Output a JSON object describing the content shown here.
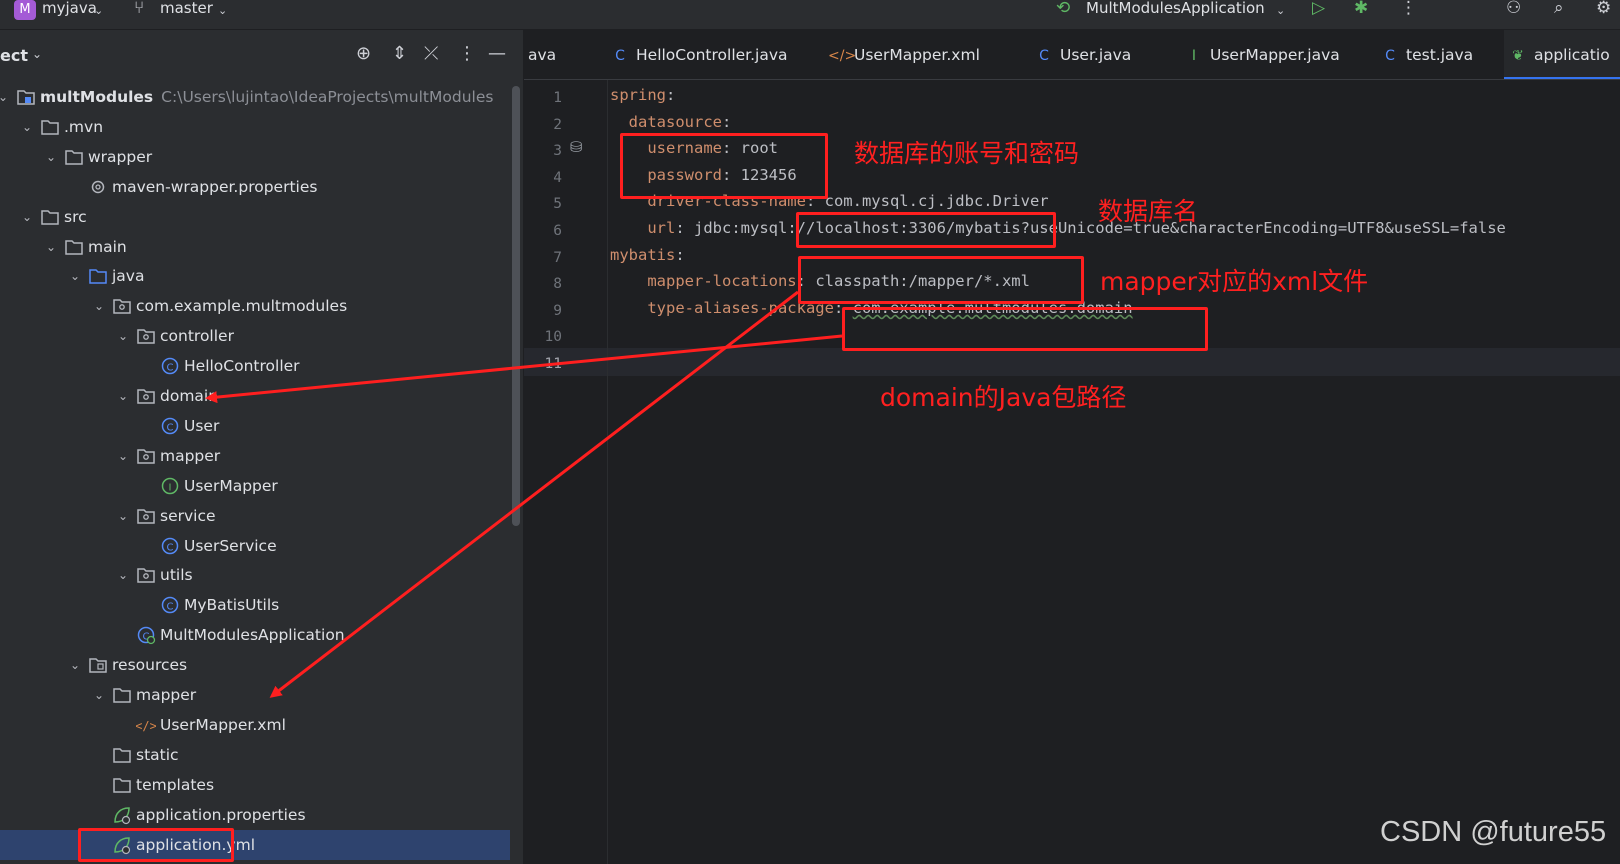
{
  "titlebar": {
    "project_badge": "M",
    "project_name": "myjava",
    "branch": "master",
    "run_config": "MultModulesApplication"
  },
  "sidebar": {
    "title": "ect",
    "tree": [
      {
        "label": "multModules",
        "path": "C:\\Users\\lujintao\\IdeaProjects\\multModules",
        "icon": "module-folder",
        "bold": true
      },
      {
        "label": ".mvn",
        "icon": "folder"
      },
      {
        "label": "wrapper",
        "icon": "folder"
      },
      {
        "label": "maven-wrapper.properties",
        "icon": "gear"
      },
      {
        "label": "src",
        "icon": "folder"
      },
      {
        "label": "main",
        "icon": "folder"
      },
      {
        "label": "java",
        "icon": "source-folder"
      },
      {
        "label": "com.example.multmodules",
        "icon": "package"
      },
      {
        "label": "controller",
        "icon": "package"
      },
      {
        "label": "HelloController",
        "icon": "class"
      },
      {
        "label": "domain",
        "icon": "package"
      },
      {
        "label": "User",
        "icon": "class"
      },
      {
        "label": "mapper",
        "icon": "package"
      },
      {
        "label": "UserMapper",
        "icon": "interface"
      },
      {
        "label": "service",
        "icon": "package"
      },
      {
        "label": "UserService",
        "icon": "class"
      },
      {
        "label": "utils",
        "icon": "package"
      },
      {
        "label": "MyBatisUtils",
        "icon": "class"
      },
      {
        "label": "MultModulesApplication",
        "icon": "spring-class"
      },
      {
        "label": "resources",
        "icon": "resource-folder"
      },
      {
        "label": "mapper",
        "icon": "folder"
      },
      {
        "label": "UserMapper.xml",
        "icon": "xml"
      },
      {
        "label": "static",
        "icon": "folder"
      },
      {
        "label": "templates",
        "icon": "folder"
      },
      {
        "label": "application.properties",
        "icon": "spring-config"
      },
      {
        "label": "application.yml",
        "icon": "spring-config"
      }
    ]
  },
  "tabs": [
    {
      "label": "ava",
      "icon": ""
    },
    {
      "label": "HelloController.java",
      "icon": "class"
    },
    {
      "label": "UserMapper.xml",
      "icon": "xml"
    },
    {
      "label": "User.java",
      "icon": "class"
    },
    {
      "label": "UserMapper.java",
      "icon": "interface"
    },
    {
      "label": "test.java",
      "icon": "class"
    },
    {
      "label": "applicatio",
      "icon": "spring-config"
    }
  ],
  "code": {
    "line_numbers": [
      "1",
      "2",
      "3",
      "4",
      "5",
      "6",
      "7",
      "8",
      "9",
      "10",
      "11"
    ],
    "lines": [
      {
        "key": "spring",
        "sep": ":",
        "value": ""
      },
      {
        "key": "  datasource",
        "sep": ":",
        "value": ""
      },
      {
        "key": "    username",
        "sep": ": ",
        "value": "root"
      },
      {
        "key": "    password",
        "sep": ": ",
        "value": "123456"
      },
      {
        "key": "    driver-class-name",
        "sep": ": ",
        "value": "com.mysql.cj.jdbc.Driver"
      },
      {
        "key": "    url",
        "sep": ": ",
        "value": "jdbc:mysql://localhost:3306/mybatis?useUnicode=true&characterEncoding=UTF8&useSSL=false"
      },
      {
        "key": "mybatis",
        "sep": ":",
        "value": ""
      },
      {
        "key": "    mapper-locations",
        "sep": ": ",
        "value": "classpath:/mapper/*.xml"
      },
      {
        "key": "    type-aliases-package",
        "sep": ": ",
        "value": "com.example.multmodules.domain"
      },
      {
        "key": "",
        "sep": "",
        "value": ""
      },
      {
        "key": "",
        "sep": "",
        "value": ""
      }
    ]
  },
  "annotations": {
    "credentials": "数据库的账号和密码",
    "db_name": "数据库名",
    "mapper_xml": "mapper对应的xml文件",
    "domain_path": "domain的Java包路径"
  },
  "watermark": "CSDN @future55",
  "colors": {
    "annotation_red": "#ff1f1f",
    "yaml_key": "#cf8e6d",
    "yaml_value": "#bcbec4",
    "selection": "#2e436e"
  }
}
